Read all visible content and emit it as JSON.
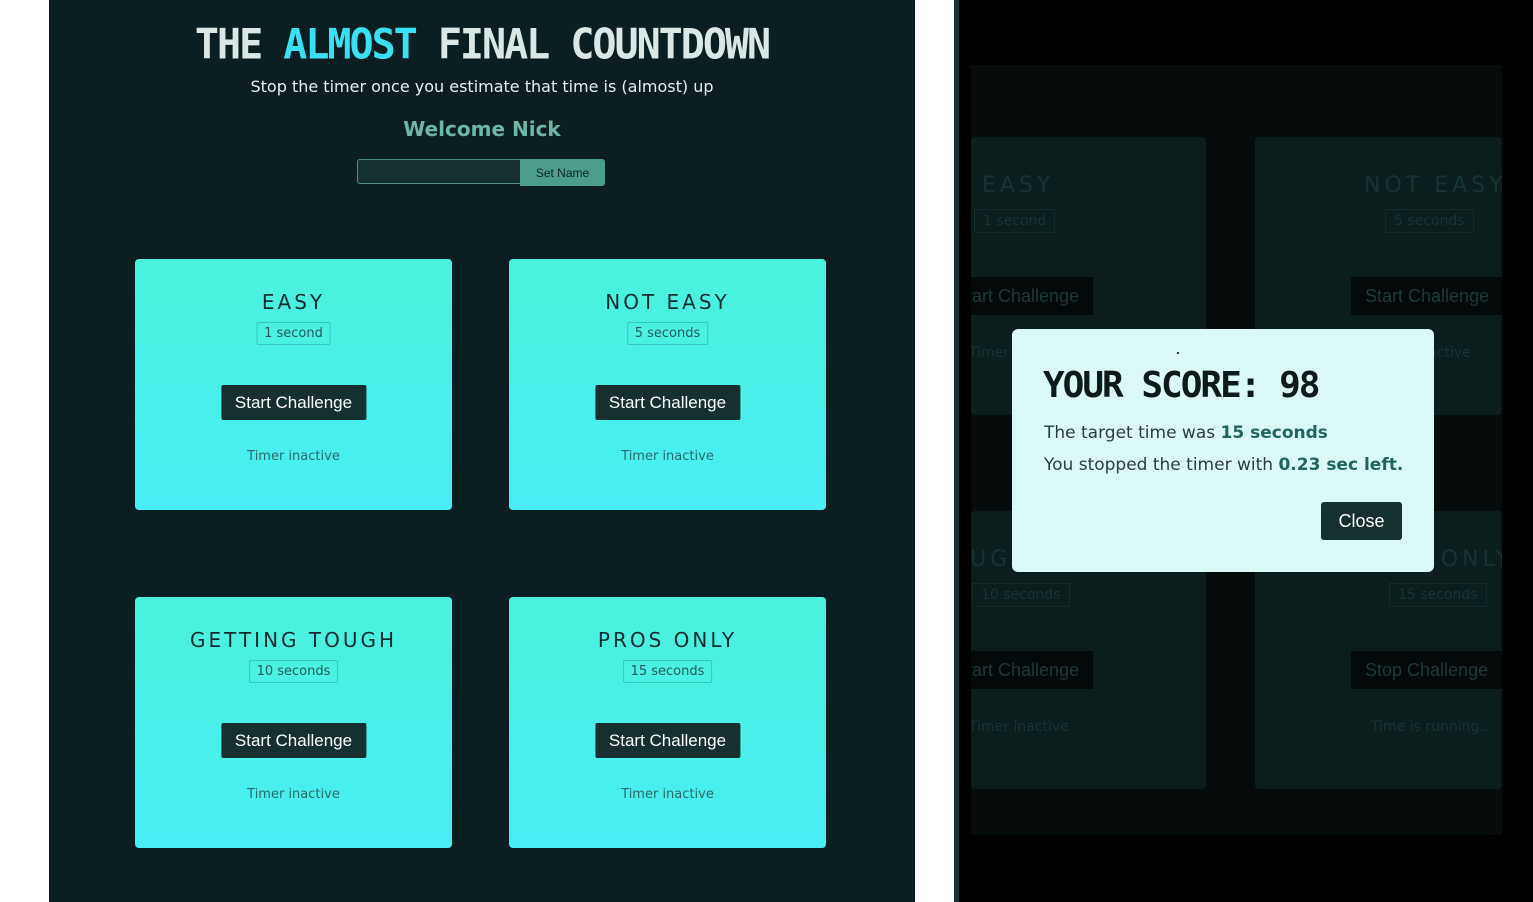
{
  "header": {
    "title_before": "THE ",
    "title_accent": "ALMOST",
    "title_after": " FINAL COUNTDOWN",
    "tagline": "Stop the timer once you estimate that time is (almost) up",
    "welcome": "Welcome Nick",
    "name_input_value": "",
    "set_name_label": "Set Name"
  },
  "cards": [
    {
      "title": "EASY",
      "badge": "1 second",
      "button": "Start Challenge",
      "status": "Timer inactive"
    },
    {
      "title": "NOT EASY",
      "badge": "5 seconds",
      "button": "Start Challenge",
      "status": "Timer inactive"
    },
    {
      "title": "GETTING TOUGH",
      "badge": "10 seconds",
      "button": "Start Challenge",
      "status": "Timer inactive"
    },
    {
      "title": "PROS ONLY",
      "badge": "15 seconds",
      "button": "Start Challenge",
      "status": "Timer inactive"
    }
  ],
  "background_cards": [
    {
      "title": "EASY",
      "badge": "1 second",
      "button": "Start Challenge",
      "status": "Timer inactive"
    },
    {
      "title": "NOT EASY",
      "badge": "5 seconds",
      "button": "Start Challenge",
      "status": "Timer inactive"
    },
    {
      "title": "GETTING TOUGH",
      "badge": "10 seconds",
      "button": "Start Challenge",
      "status": "Timer inactive"
    },
    {
      "title": "PROS ONLY",
      "badge": "15 seconds",
      "button": "Stop Challenge",
      "status": "Time is running..."
    }
  ],
  "modal": {
    "title": "YOUR SCORE: 98",
    "target_prefix": "The target time was ",
    "target_value": "15 seconds",
    "stopped_prefix": "You stopped the timer with ",
    "stopped_value": "0.23 sec left.",
    "close_label": "Close"
  },
  "colors": {
    "page_bg": "#0b1e22",
    "accent_cyan": "#3ae0f3",
    "card_top": "#4bf2dd",
    "card_bottom": "#48eef4",
    "button_dark": "#16302f",
    "modal_bg": "#daf9f6",
    "welcome_green": "#6db7a5"
  }
}
